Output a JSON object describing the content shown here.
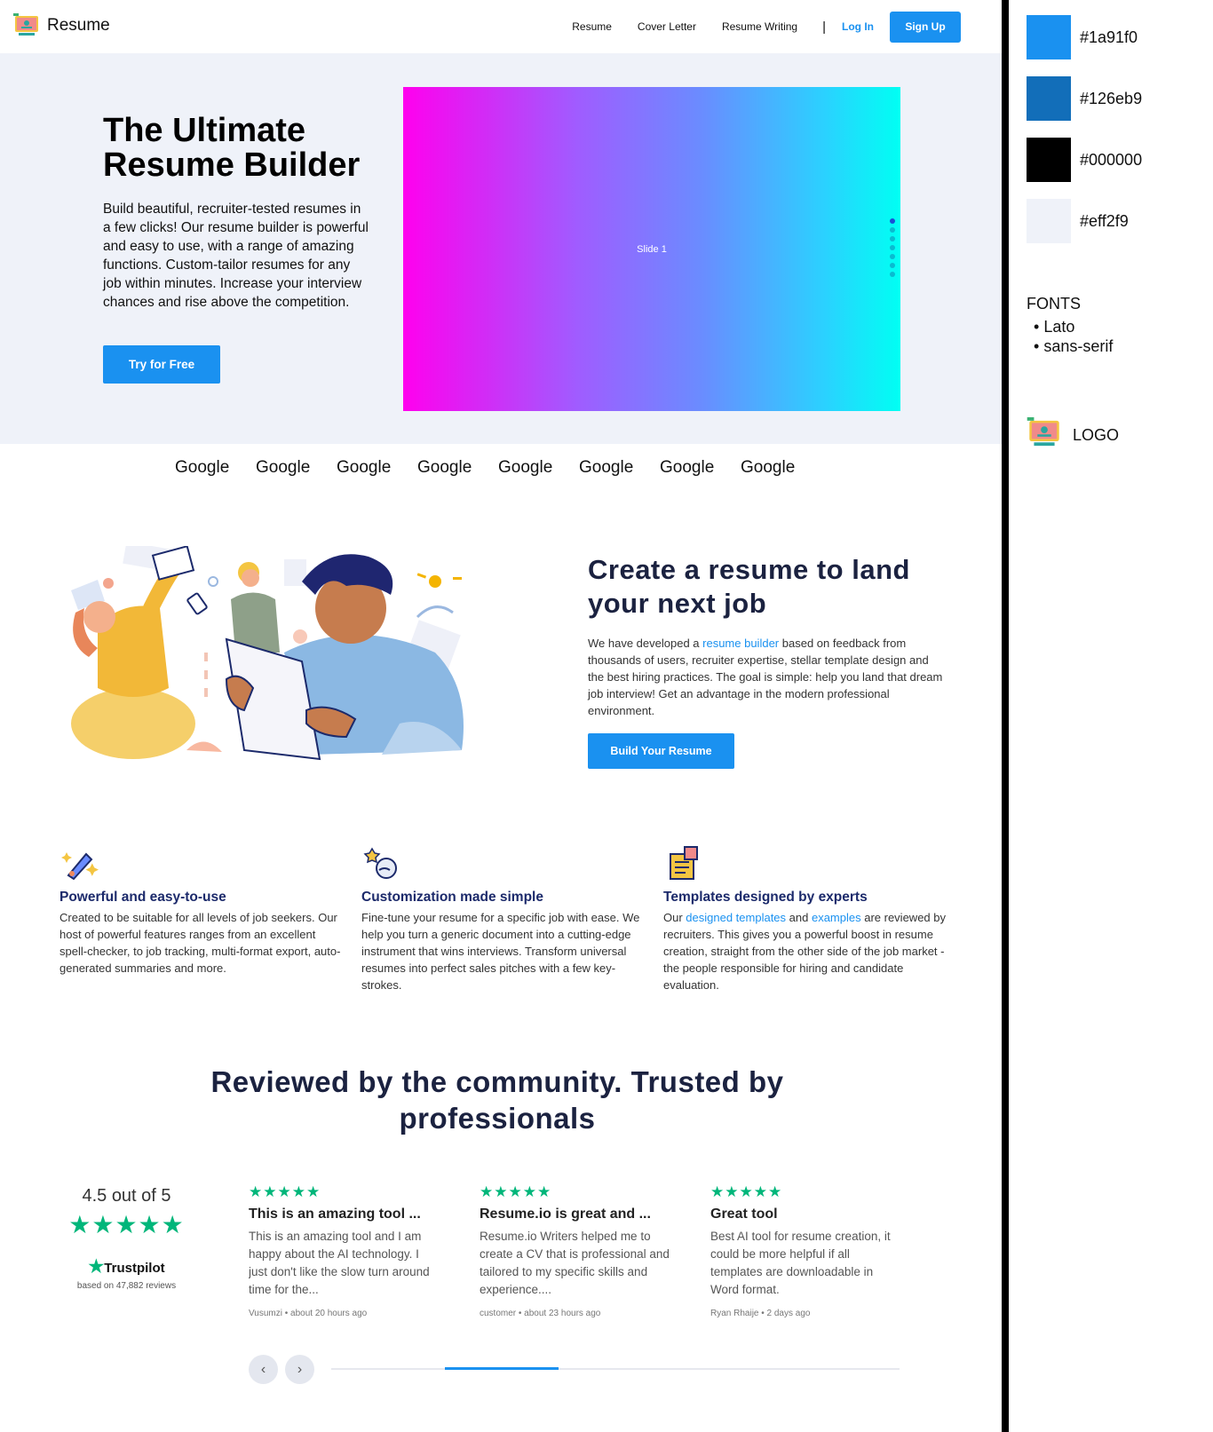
{
  "header": {
    "brand": "Resume",
    "nav": [
      "Resume",
      "Cover Letter",
      "Resume Writing"
    ],
    "separator": "|",
    "login": "Log In",
    "signup": "Sign Up"
  },
  "hero": {
    "title": "The Ultimate Resume Builder",
    "text": "Build beautiful, recruiter-tested resumes in a few clicks! Our resume builder is powerful and easy to use, with a range of amazing functions. Custom-tailor resumes for any job within minutes. Increase your interview chances and rise above the competition.",
    "cta": "Try for Free",
    "slide_label": "Slide 1",
    "slide_count": 7,
    "active_slide": 1
  },
  "logos": [
    "Google",
    "Google",
    "Google",
    "Google",
    "Google",
    "Google",
    "Google",
    "Google"
  ],
  "create": {
    "title": "Create a resume to land your next job",
    "text_before": "We have developed a ",
    "link": "resume builder",
    "text_after": " based on feedback from thousands of users, recruiter expertise, stellar template design and the best hiring practices. The goal is simple: help you land that dream job interview! Get an advantage in the modern professional environment.",
    "cta": "Build Your Resume"
  },
  "features": [
    {
      "icon": "sparkle-pen-icon",
      "title": "Powerful and easy-to-use",
      "text": "Created to be suitable for all levels of job seekers. Our host of powerful features ranges from an excellent spell-checker, to job tracking, multi-format export, auto-generated summaries and more."
    },
    {
      "icon": "customize-icon",
      "title": "Customization made simple",
      "text": "Fine-tune your resume for a specific job with ease. We help you turn a generic document into a cutting-edge instrument that wins interviews. Transform universal resumes into perfect sales pitches with a few key-strokes."
    },
    {
      "icon": "template-document-icon",
      "title": "Templates designed by experts",
      "text_1": "Our ",
      "link_1": "designed templates",
      "text_2": " and ",
      "link_2": "examples",
      "text_3": " are reviewed by recruiters. This gives you a powerful boost in resume creation, straight from the other side of the job market - the people responsible for hiring and candidate evaluation."
    }
  ],
  "reviews": {
    "title": "Reviewed by the community. Trusted by professionals",
    "score_text": "4.5 out of 5",
    "score": 4.5,
    "stars": "★★★★★",
    "trustpilot": "Trustpilot",
    "based_on": "based on 47,882 reviews",
    "items": [
      {
        "stars": "★★★★★",
        "title": "This is an amazing tool ...",
        "text": "This is an amazing tool and I am happy about the AI technology. I just don't like the slow turn around time for the...",
        "meta": "Vusumzi • about 20 hours ago"
      },
      {
        "stars": "★★★★★",
        "title": "Resume.io is great and ...",
        "text": "Resume.io Writers helped me to create a CV that is professional and tailored to my specific skills and experience....",
        "meta": "customer • about 23 hours ago"
      },
      {
        "stars": "★★★★★",
        "title": "Great tool",
        "text": "Best AI tool for resume creation, it could be more helpful if all templates are downloadable in Word format.",
        "meta": "Ryan Rhaije • 2 days ago"
      }
    ],
    "prev": "‹",
    "next": "›",
    "progress": 0.2
  },
  "style_guide": {
    "colors": [
      {
        "hex": "#1a91f0",
        "label": "#1a91f0"
      },
      {
        "hex": "#126eb9",
        "label": "#126eb9"
      },
      {
        "hex": "#000000",
        "label": "#000000"
      },
      {
        "hex": "#eff2f9",
        "label": "#eff2f9"
      }
    ],
    "fonts_heading": "FONTS",
    "fonts": [
      "Lato",
      "sans-serif"
    ],
    "logo_label": "LOGO"
  },
  "colors": {
    "accent": "#1a91f0",
    "accent_dark": "#126eb9",
    "hero_bg": "#eff2f9",
    "star_green": "#00b67a",
    "heading_navy": "#1b2240"
  }
}
